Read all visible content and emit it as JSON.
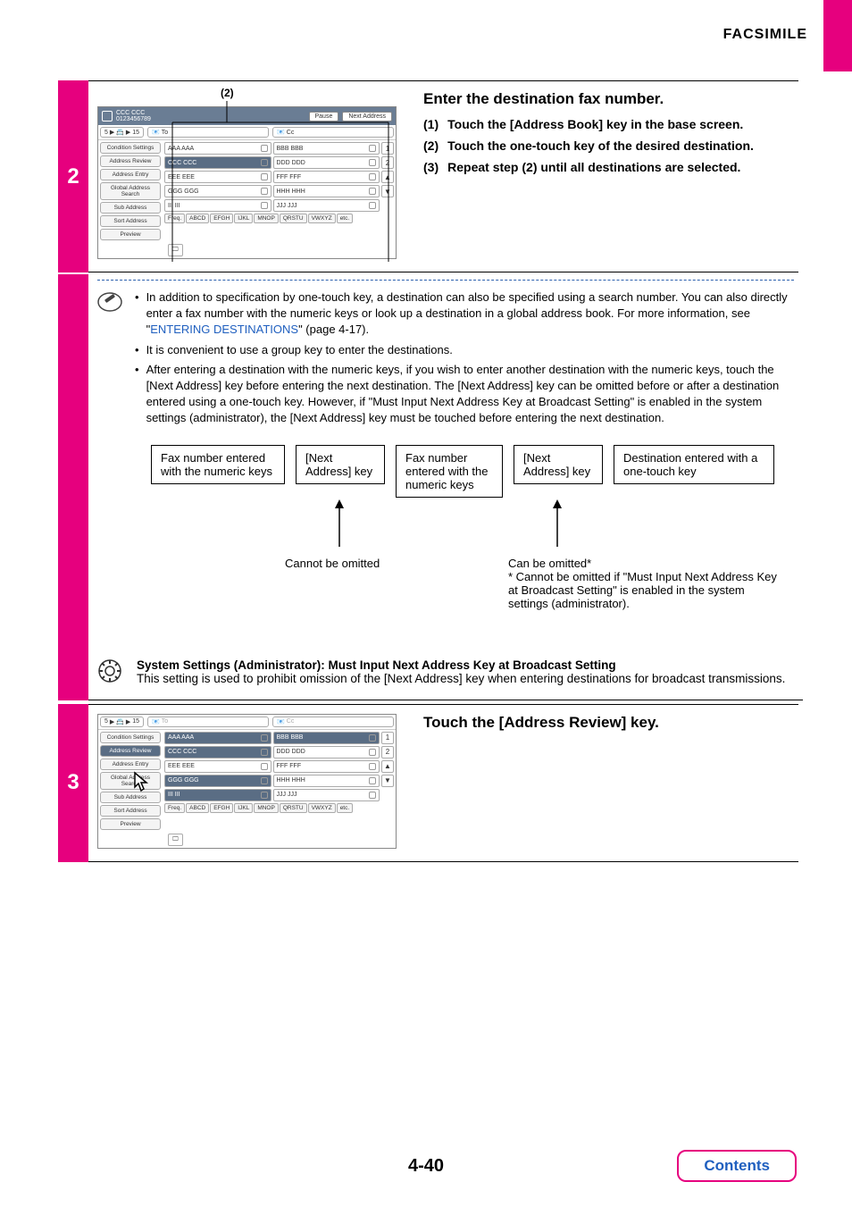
{
  "header": {
    "title": "FACSIMILE"
  },
  "step2": {
    "number": "2",
    "callout": "(2)",
    "screenshot": {
      "topbar": {
        "title1": "CCC CCC",
        "title2": "0123456789",
        "pause": "Pause",
        "next": "Next Address"
      },
      "row2": {
        "count": "5",
        "mid": "15",
        "to": "To",
        "cc": "Cc"
      },
      "sidebar": [
        "Condition Settings",
        "Address Review",
        "Address Entry",
        "Global Address Search",
        "Sub Address",
        "Sort Address",
        "Preview"
      ],
      "grid": [
        [
          "AAA AAA",
          "BBB BBB"
        ],
        [
          "CCC CCC",
          "DDD DDD"
        ],
        [
          "EEE EEE",
          "FFF FFF"
        ],
        [
          "GGG GGG",
          "HHH HHH"
        ],
        [
          "III III",
          "JJJ JJJ"
        ]
      ],
      "pages": [
        "1",
        "2"
      ],
      "tabs": [
        "Freq.",
        "ABCD",
        "EFGH",
        "IJKL",
        "MNOP",
        "QRSTU",
        "VWXYZ",
        "etc."
      ]
    },
    "instr": {
      "title": "Enter the destination fax number.",
      "items": [
        {
          "n": "(1)",
          "t": "Touch the [Address Book] key in the base screen."
        },
        {
          "n": "(2)",
          "t": "Touch the one-touch key of the desired destination."
        },
        {
          "n": "(3)",
          "t": "Repeat step (2) until all destinations are selected."
        }
      ]
    },
    "notes": {
      "bullet1a": "In addition to specification by one-touch key, a destination can also be specified using a search number. You can also directly enter a fax number with the numeric keys or look up a destination in a global address book. For more information, see \"",
      "bullet1link": "ENTERING DESTINATIONS",
      "bullet1b": "\" (page 4-17).",
      "bullet2": "It is convenient to use a group key to enter the destinations.",
      "bullet3": "After entering a destination with the numeric keys, if you wish to enter another destination with the numeric keys, touch the [Next Address] key before entering the next destination. The [Next Address] key can be omitted before or after a destination entered using a one-touch key. However, if \"Must Input Next Address Key at Broadcast Setting\" is enabled in the system settings (administrator), the [Next Address] key must be touched before entering the next destination."
    },
    "flow": {
      "b1": "Fax number entered with the numeric keys",
      "b2": "[Next Address] key",
      "b3": "Fax number entered with the numeric keys",
      "b4": "[Next Address] key",
      "b5": "Destination entered with a one-touch key",
      "cap1": "Cannot be omitted",
      "cap2": "Can be omitted*",
      "cap2note": "* Cannot be omitted if \"Must Input Next Address Key at Broadcast Setting\" is enabled in the system settings (administrator)."
    },
    "admin": {
      "title": "System Settings (Administrator): Must Input Next Address Key at Broadcast Setting",
      "body": "This setting is used to prohibit omission of the [Next Address] key when entering destinations for broadcast transmissions."
    }
  },
  "step3": {
    "number": "3",
    "title": "Touch the [Address Review] key.",
    "screenshot": {
      "row2": {
        "count": "5",
        "mid": "15",
        "to": "To",
        "cc": "Cc"
      },
      "sidebar": [
        "Condition Settings",
        "Address Review",
        "Address Entry",
        "Global Address Search",
        "Sub Address",
        "Sort Address",
        "Preview"
      ],
      "grid": [
        [
          "AAA AAA",
          "BBB BBB"
        ],
        [
          "CCC CCC",
          "DDD DDD"
        ],
        [
          "EEE EEE",
          "FFF FFF"
        ],
        [
          "GGG GGG",
          "HHH HHH"
        ],
        [
          "III III",
          "JJJ JJJ"
        ]
      ],
      "pages": [
        "1",
        "2"
      ],
      "tabs": [
        "Freq.",
        "ABCD",
        "EFGH",
        "IJKL",
        "MNOP",
        "QRSTU",
        "VWXYZ",
        "etc."
      ]
    }
  },
  "footer": {
    "page": "4-40",
    "contents": "Contents"
  }
}
